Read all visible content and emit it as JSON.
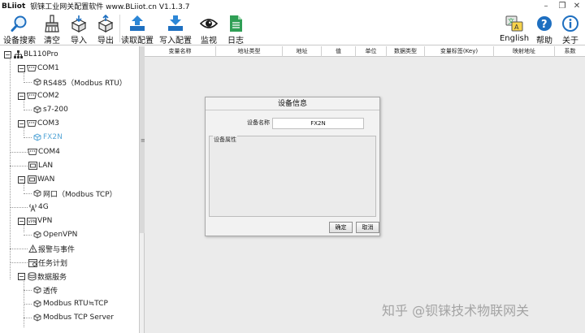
{
  "titlebar": {
    "brand": "BLiiot",
    "title": "钡铼工业网关配置软件 www.BLiiot.cn V1.1.3.7",
    "minimize": "–",
    "restore": "❐",
    "close": "✕"
  },
  "toolbar": {
    "device_search": "设备搜索",
    "clear": "清空",
    "import": "导入",
    "export": "导出",
    "read_config": "读取配置",
    "write_config": "写入配置",
    "monitor": "监视",
    "log": "日志",
    "english": "English",
    "help": "帮助",
    "about": "关于"
  },
  "tree": {
    "root": "BL110Pro",
    "com1": "COM1",
    "com1_child": "RS485（Modbus RTU）",
    "com2": "COM2",
    "com2_child": "s7-200",
    "com3": "COM3",
    "com3_child": "FX2N",
    "com4": "COM4",
    "lan": "LAN",
    "wan": "WAN",
    "wan_child": "网口（Modbus TCP）",
    "g4": "4G",
    "vpn": "VPN",
    "vpn_child": "OpenVPN",
    "alarm": "报警与事件",
    "task": "任务计划",
    "data_service": "数据服务",
    "ds_child1": "透传",
    "ds_child2": "Modbus RTU≒TCP",
    "ds_child3": "Modbus TCP Server"
  },
  "table": {
    "headers": [
      "变量名称",
      "地址类型",
      "地址",
      "值",
      "单位",
      "数据类型",
      "变量标签(Key)",
      "映射地址",
      "系数"
    ]
  },
  "dialog": {
    "title": "设备信息",
    "name_label": "设备名称",
    "name_value": "FX2N",
    "group_title": "设备属性",
    "ok": "确定",
    "cancel": "取消"
  },
  "watermark": "知乎 @钡铼技术物联网关",
  "colors": {
    "accent_blue": "#1e6fc0",
    "selected_node": "#5aa8d8"
  }
}
